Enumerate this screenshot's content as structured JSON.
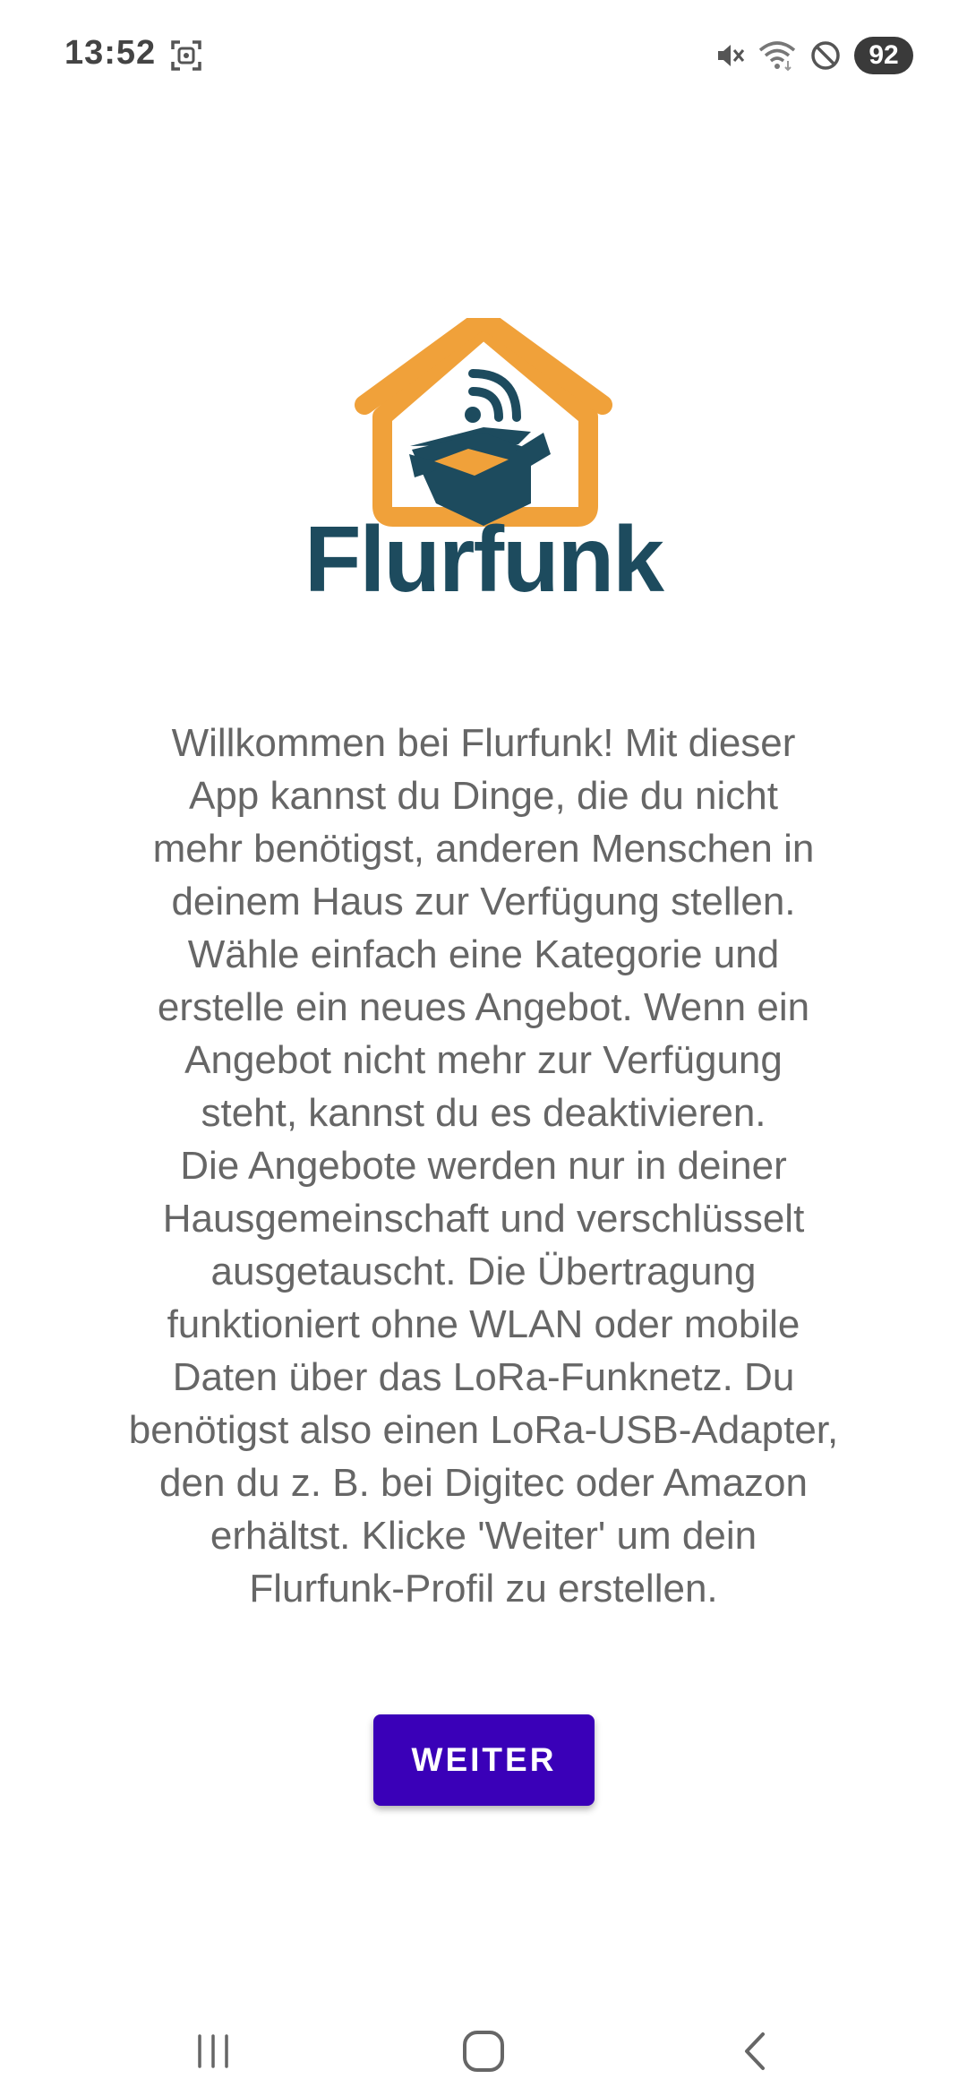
{
  "status_bar": {
    "time": "13:52",
    "battery": "92",
    "icons": [
      "screenshot-icon",
      "mute-icon",
      "wifi-icon",
      "do-not-disturb-icon"
    ]
  },
  "logo": {
    "wordmark": "Flurfunk",
    "colors": {
      "house": "#f0a13a",
      "box": "#1d4b5e",
      "box_inner": "#f0a13a"
    }
  },
  "welcome": {
    "text": "Willkommen bei Flurfunk! Mit dieser\nApp kannst du Dinge, die du nicht\nmehr benötigst, anderen Menschen in\ndeinem Haus zur Verfügung stellen.\nWähle einfach eine Kategorie und\nerstelle ein neues Angebot. Wenn ein\nAngebot nicht mehr zur Verfügung\nsteht, kannst du es deaktivieren.\nDie Angebote werden nur in deiner\nHausgemeinschaft und verschlüsselt\nausgetauscht. Die Übertragung\nfunktioniert ohne WLAN oder mobile\nDaten über das LoRa-Funknetz. Du\nbenötigst also einen LoRa-USB-Adapter,\nden du z. B. bei Digitec oder Amazon\nerhältst. Klicke 'Weiter' um dein\nFlurfunk-Profil zu erstellen."
  },
  "button": {
    "label": "WEITER",
    "color": "#3a00b8"
  },
  "nav_bar": {
    "icons": [
      "recent-apps-icon",
      "home-icon",
      "back-icon"
    ]
  }
}
